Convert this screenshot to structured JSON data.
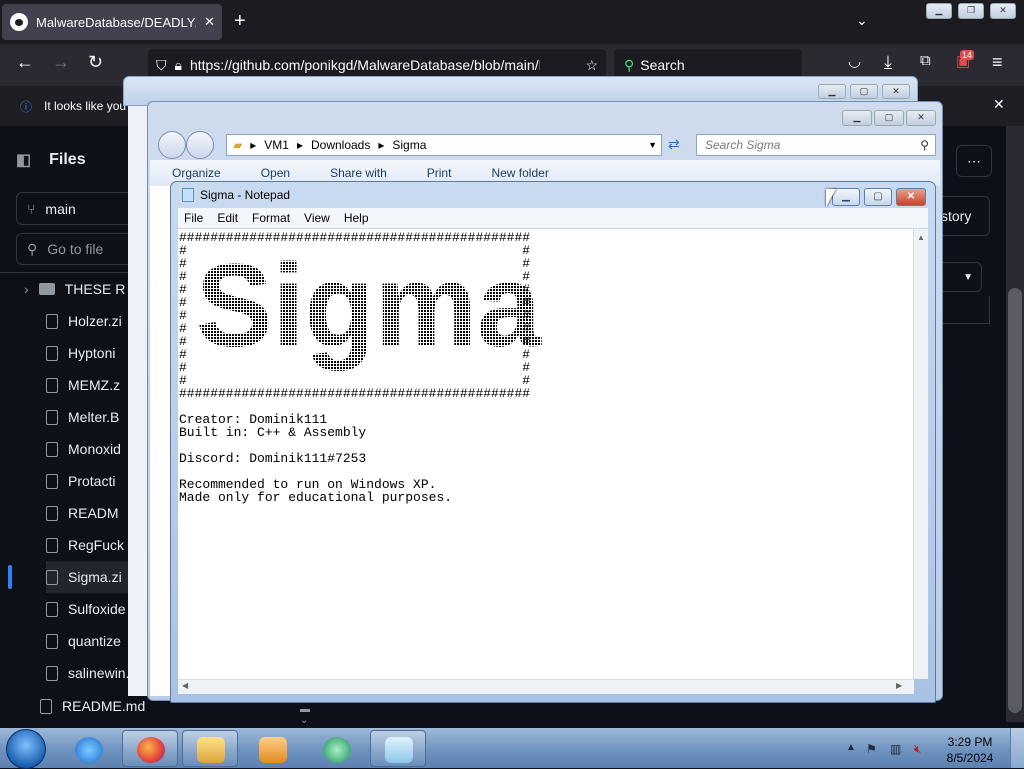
{
  "browser": {
    "tab_title": "MalwareDatabase/DEADLY/Sigma",
    "new_tab_label": "+",
    "url": "https://github.com/ponikgd/MalwareDatabase/blob/main/D",
    "search_label": "Search",
    "extensions_badge": "14",
    "notice_text": "It looks like you"
  },
  "github": {
    "files_title": "Files",
    "branch": "main",
    "go_to_file": "Go to file",
    "history_label": "story",
    "tree": [
      {
        "label": "THESE R",
        "type": "folder"
      },
      {
        "label": "Holzer.zi",
        "type": "file"
      },
      {
        "label": "Hyptoni",
        "type": "file"
      },
      {
        "label": "MEMZ.z",
        "type": "file"
      },
      {
        "label": "Melter.B",
        "type": "file"
      },
      {
        "label": "Monoxid",
        "type": "file"
      },
      {
        "label": "Protacti",
        "type": "file"
      },
      {
        "label": "READM",
        "type": "file"
      },
      {
        "label": "RegFuck",
        "type": "file"
      },
      {
        "label": "Sigma.zi",
        "type": "file",
        "selected": true
      },
      {
        "label": "Sulfoxide",
        "type": "file"
      },
      {
        "label": "quantize",
        "type": "file"
      },
      {
        "label": "salinewin.zip",
        "type": "file"
      }
    ],
    "readme": "README.md"
  },
  "explorer": {
    "path": [
      "VM1",
      "Downloads",
      "Sigma"
    ],
    "search_placeholder": "Search Sigma",
    "toolbar": [
      "Organize",
      "Open",
      "Share with",
      "Print",
      "New folder"
    ]
  },
  "notepad": {
    "title": "Sigma - Notepad",
    "menu": [
      "File",
      "Edit",
      "Format",
      "View",
      "Help"
    ],
    "content": "#############################################\n#                                           #\n#                                           #\n#                                           #\n#                                           #\n#                                           #\n#                                           #\n#                                           #\n#                                           #\n#                                           #\n#                                           #\n#                                           #\n#############################################\n\nCreator: Dominik111\nBuilt in: C++ & Assembly\n\nDiscord: Dominik111#7253\n\nRecommended to run on Windows XP.\nMade only for educational purposes.",
    "art_text": "Sigma"
  },
  "taskbar": {
    "time": "3:29 PM",
    "date": "8/5/2024"
  },
  "colors": {
    "github_bg": "#0d1117",
    "browser_chrome": "#2b2a33",
    "accent_blue": "#2f81f7",
    "win7_taskbar": "#6f93bf"
  }
}
